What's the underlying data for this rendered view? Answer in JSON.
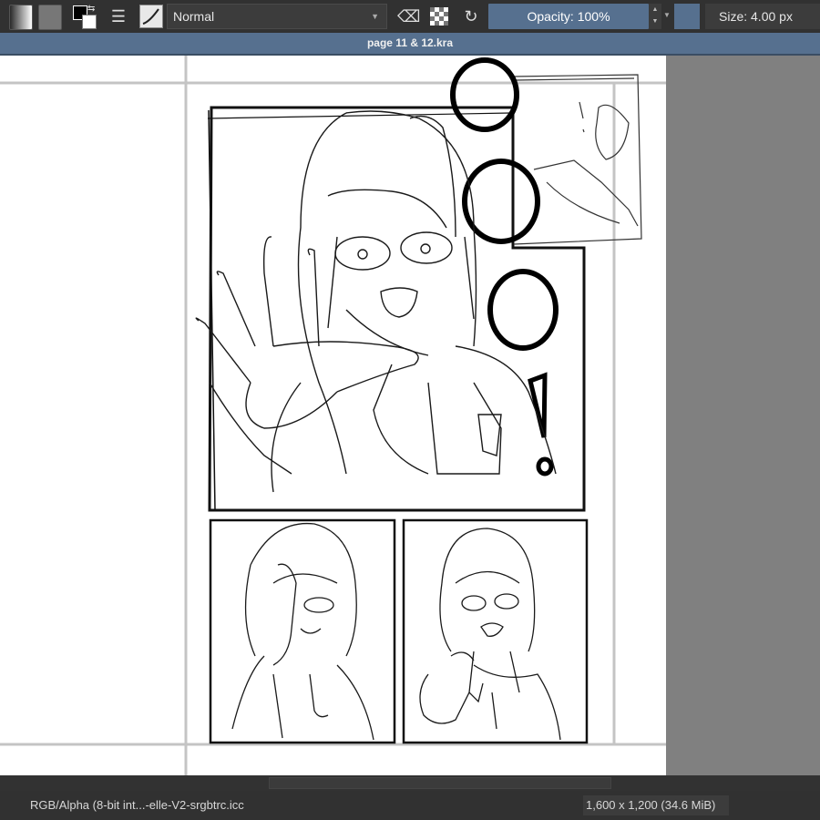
{
  "toolbar": {
    "blend_mode": "Normal",
    "opacity_label": "Opacity: 100%",
    "size_label": "Size: 4.00 px",
    "icons": [
      "gradient-icon",
      "pattern-icon",
      "fg-bg-color-icon",
      "brush-settings-icon",
      "brush-preset-icon",
      "eraser-icon",
      "alpha-lock-icon",
      "reload-preset-icon"
    ],
    "accent_color": "#56708f"
  },
  "document": {
    "tab_title": "page 11 & 12.kra"
  },
  "canvas": {
    "sketch_text": [
      "!"
    ]
  },
  "status_bar": {
    "color_profile": "RGB/Alpha (8-bit int...-elle-V2-srgbtrc.icc",
    "dimensions": "1,600 x 1,200 (34.6 MiB)"
  }
}
